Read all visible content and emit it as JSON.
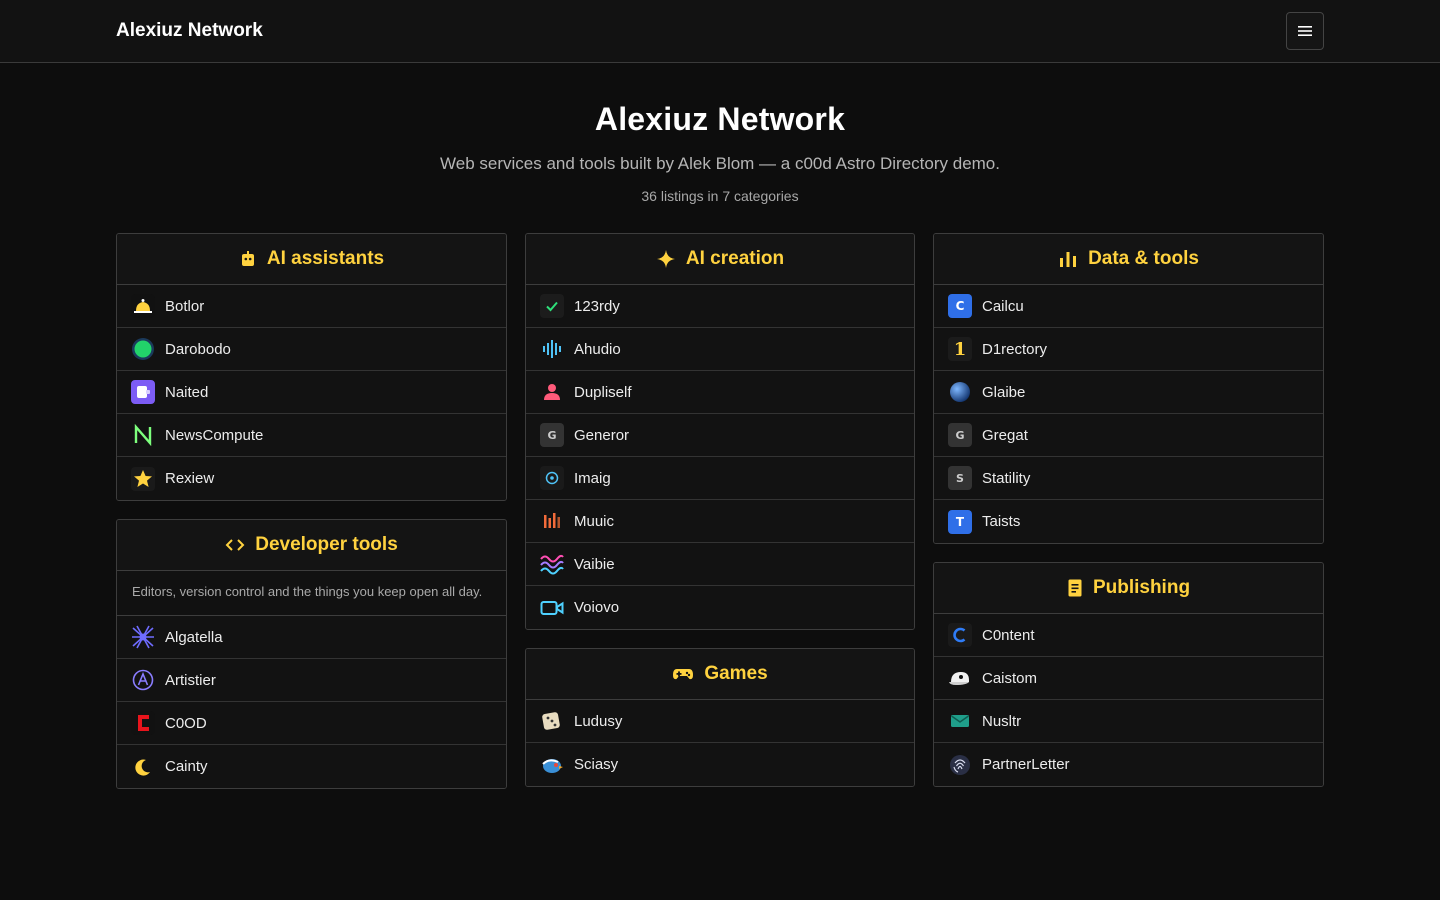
{
  "header": {
    "brand": "Alexiuz Network",
    "menu_icon": "hamburger-menu-icon"
  },
  "hero": {
    "title": "Alexiuz Network",
    "subtitle": "Web services and tools built by Alek Blom — a c00d Astro Directory demo.",
    "count": "36 listings in 7 categories"
  },
  "categories": {
    "ai_assistants": {
      "title": "AI assistants",
      "icon": "robot-icon",
      "items": [
        {
          "label": "Botlor",
          "icon": "bell-icon"
        },
        {
          "label": "Darobodo",
          "icon": "green-circle-icon"
        },
        {
          "label": "Naited",
          "icon": "purple-app-icon"
        },
        {
          "label": "NewsCompute",
          "icon": "letter-n-icon"
        },
        {
          "label": "Rexiew",
          "icon": "star-icon"
        }
      ]
    },
    "ai_creation": {
      "title": "AI creation",
      "icon": "sparkle-icon",
      "items": [
        {
          "label": "123rdy",
          "icon": "check-icon"
        },
        {
          "label": "Ahudio",
          "icon": "waveform-icon"
        },
        {
          "label": "Dupliself",
          "icon": "person-icon"
        },
        {
          "label": "Generor",
          "icon": "letter-g-icon",
          "letter": "G"
        },
        {
          "label": "Imaig",
          "icon": "target-icon"
        },
        {
          "label": "Muuic",
          "icon": "bars-icon"
        },
        {
          "label": "Vaibie",
          "icon": "waves-icon"
        },
        {
          "label": "Voiovo",
          "icon": "video-camera-icon"
        }
      ]
    },
    "data_tools": {
      "title": "Data & tools",
      "icon": "bar-chart-icon",
      "items": [
        {
          "label": "Cailcu",
          "icon": "letter-c-icon",
          "letter": "C"
        },
        {
          "label": "D1rectory",
          "icon": "numeral-one-icon",
          "letter": "1"
        },
        {
          "label": "Glaibe",
          "icon": "globe-icon"
        },
        {
          "label": "Gregat",
          "icon": "letter-g-icon",
          "letter": "G"
        },
        {
          "label": "Statility",
          "icon": "letter-s-icon",
          "letter": "S"
        },
        {
          "label": "Taists",
          "icon": "letter-t-icon",
          "letter": "T"
        }
      ]
    },
    "developer_tools": {
      "title": "Developer tools",
      "icon": "code-brackets-icon",
      "description": "Editors, version control and the things you keep open all day.",
      "items": [
        {
          "label": "Algatella",
          "icon": "spider-icon"
        },
        {
          "label": "Artistier",
          "icon": "letter-a-circle-icon",
          "letter": "A"
        },
        {
          "label": "C0OD",
          "icon": "red-c-icon"
        },
        {
          "label": "Cainty",
          "icon": "moon-icon"
        }
      ]
    },
    "games": {
      "title": "Games",
      "icon": "gamepad-icon",
      "items": [
        {
          "label": "Ludusy",
          "icon": "dice-icon"
        },
        {
          "label": "Sciasy",
          "icon": "bird-icon"
        }
      ]
    },
    "publishing": {
      "title": "Publishing",
      "icon": "document-icon",
      "items": [
        {
          "label": "C0ntent",
          "icon": "c-logo-icon"
        },
        {
          "label": "Caistom",
          "icon": "cap-icon"
        },
        {
          "label": "Nusltr",
          "icon": "envelope-icon"
        },
        {
          "label": "PartnerLetter",
          "icon": "fingerprint-icon"
        }
      ]
    }
  },
  "colors": {
    "accent": "#ffd23f",
    "background": "#0d0d0d",
    "border": "#3d3d3d"
  }
}
